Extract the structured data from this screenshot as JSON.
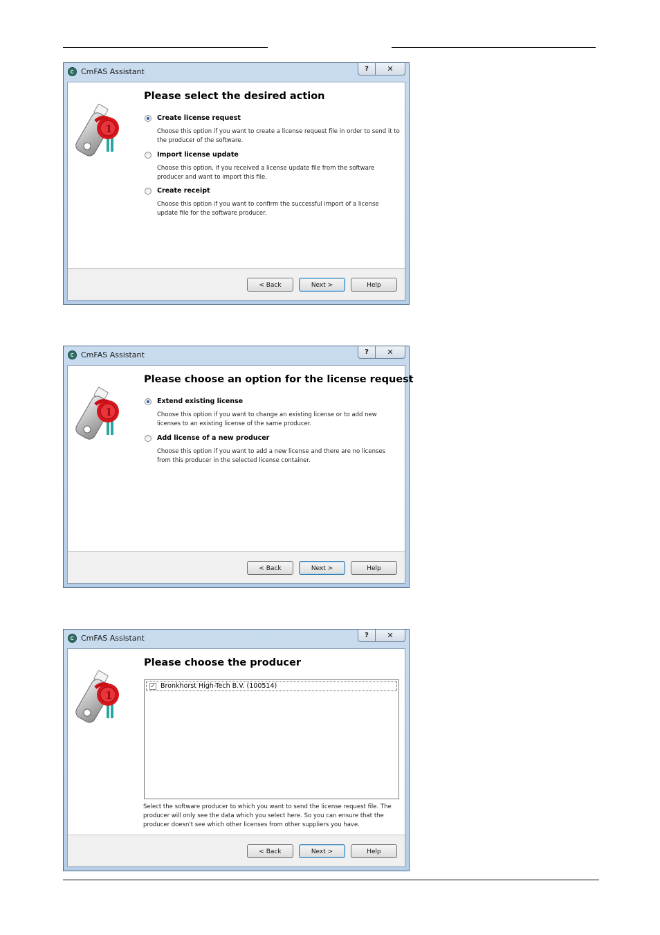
{
  "dialogs": [
    {
      "title": "CmFAS Assistant",
      "help_glyph": "?",
      "close_glyph": "✕",
      "heading": "Please select the desired action",
      "options": [
        {
          "label": "Create license request",
          "desc": "Choose this option if you want to create a license request file in order to send it to the producer of the software.",
          "selected": true
        },
        {
          "label": "Import license update",
          "desc": "Choose this option, if you received a license update file from the software producer and want to import this file.",
          "selected": false
        },
        {
          "label": "Create receipt",
          "desc": "Choose this option if you want to confirm the successful import of a license update file for the software producer.",
          "selected": false
        }
      ],
      "buttons": {
        "back": "< Back",
        "next": "Next >",
        "help": "Help"
      }
    },
    {
      "title": "CmFAS Assistant",
      "help_glyph": "?",
      "close_glyph": "✕",
      "heading": "Please choose an option for the license request",
      "options": [
        {
          "label": "Extend existing license",
          "desc": "Choose this option if you want to change an existing license or to add new licenses to an existing license of the same producer.",
          "selected": true
        },
        {
          "label": "Add license of a new producer",
          "desc": "Choose this option if you want to add a new license and there are no licenses from this producer in the selected license container.",
          "selected": false
        }
      ],
      "buttons": {
        "back": "< Back",
        "next": "Next >",
        "help": "Help"
      }
    },
    {
      "title": "CmFAS Assistant",
      "help_glyph": "?",
      "close_glyph": "✕",
      "heading": "Please choose the producer",
      "producers": [
        {
          "label": "Bronkhorst High-Tech B.V. (100514)",
          "checked": true
        }
      ],
      "check_glyph": "✓",
      "note": "Select the software producer to which you want to send the license request file. The producer will only see the data which you select here. So you can ensure that the producer doesn't see which other licenses from other suppliers you have.",
      "buttons": {
        "back": "< Back",
        "next": "Next >",
        "help": "Help"
      }
    }
  ],
  "colors": {
    "accent": "#2a5ea8",
    "seal_red": "#d9141b",
    "frame": "#b5cde6"
  },
  "icons": [
    "cmfas-app-icon",
    "usb-dongle-seal-icon"
  ]
}
